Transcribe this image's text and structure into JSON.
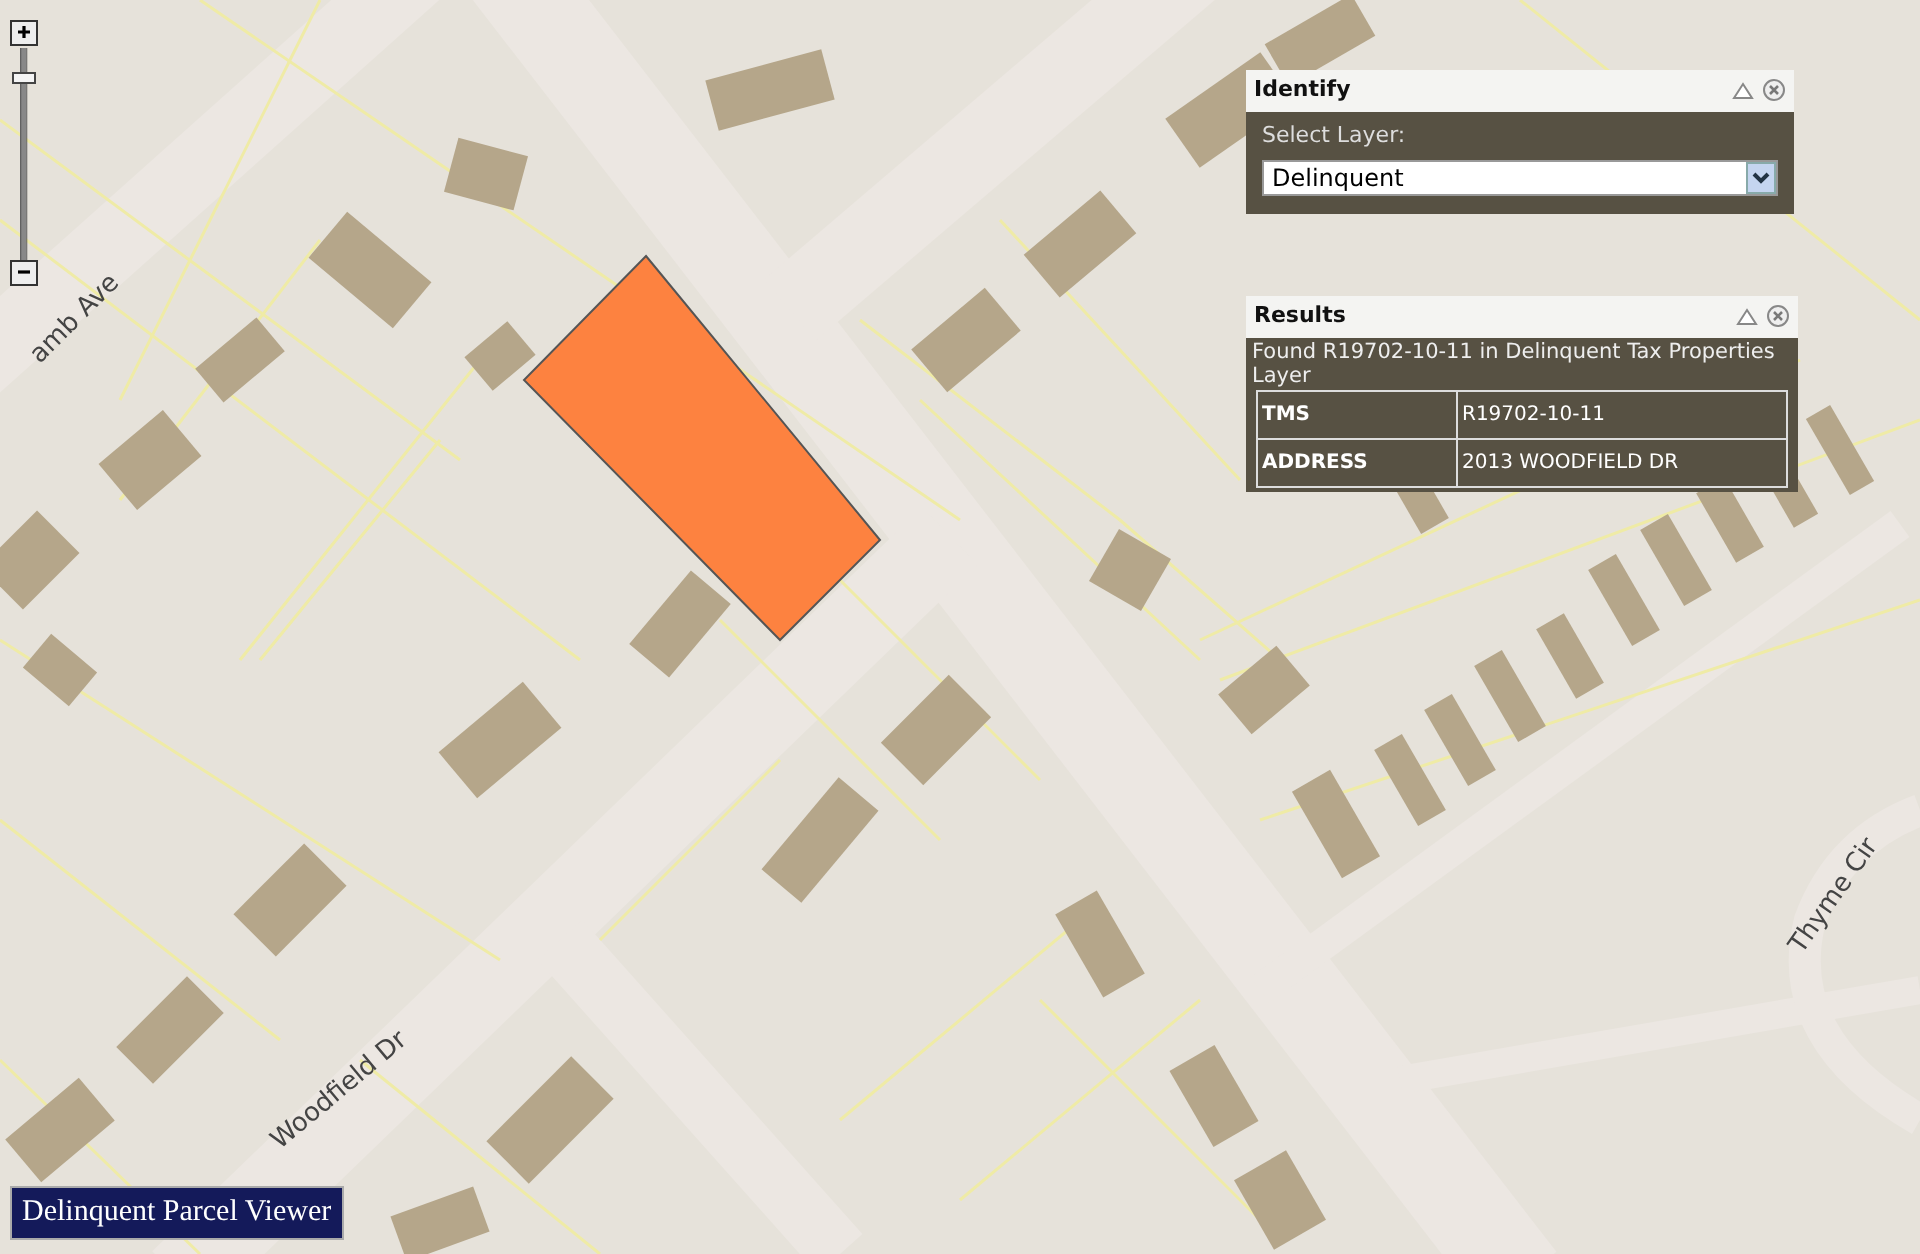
{
  "map": {
    "street_labels": [
      {
        "text": "amb Ave",
        "kind": "lamb"
      },
      {
        "text": "Woodfield Dr",
        "kind": "woodfield"
      },
      {
        "text": "Thyme Cir",
        "kind": "thyme"
      }
    ],
    "zoom": {
      "level": 0.88
    }
  },
  "identify": {
    "title": "Identify",
    "label": "Select Layer:",
    "value": "Delinquent"
  },
  "results": {
    "title": "Results",
    "message": "Found R19702-10-11 in Delinquent Tax Properties Layer",
    "rows": [
      {
        "field": "TMS",
        "value": "R19702-10-11"
      },
      {
        "field": "ADDRESS",
        "value": "2013 WOODFIELD DR"
      }
    ]
  },
  "banner": {
    "title": "Delinquent Parcel Viewer"
  }
}
